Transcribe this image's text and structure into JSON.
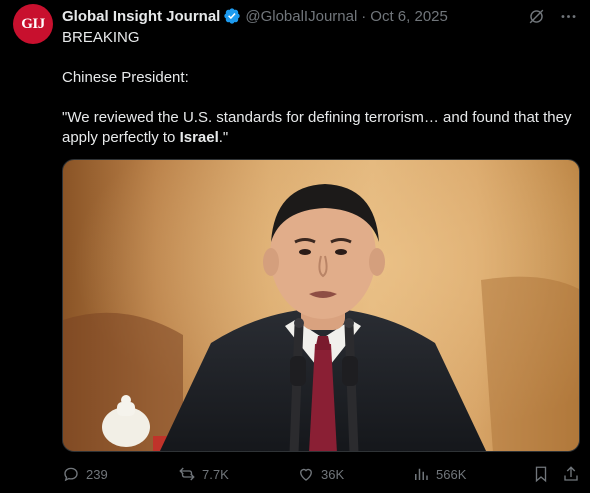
{
  "post": {
    "avatar_text": "GIJ",
    "display_name": "Global Insight Journal",
    "handle": "@GlobalIJournal",
    "separator": "·",
    "date": "Oct 6, 2025",
    "lines": {
      "line1": "BREAKING",
      "line2": "Chinese President:",
      "quote_part1": "\"We reviewed the U.S. standards for defining terrorism… and found that they apply perfectly to ",
      "quote_bold": "Israel",
      "quote_part2": ".\""
    }
  },
  "actions": {
    "replies": "239",
    "reposts": "7.7K",
    "likes": "36K",
    "views": "566K"
  },
  "colors": {
    "background": "#000000",
    "text": "#e7e9ea",
    "muted": "#71767b",
    "verified": "#1d9bf0",
    "avatar": "#c8102e"
  }
}
